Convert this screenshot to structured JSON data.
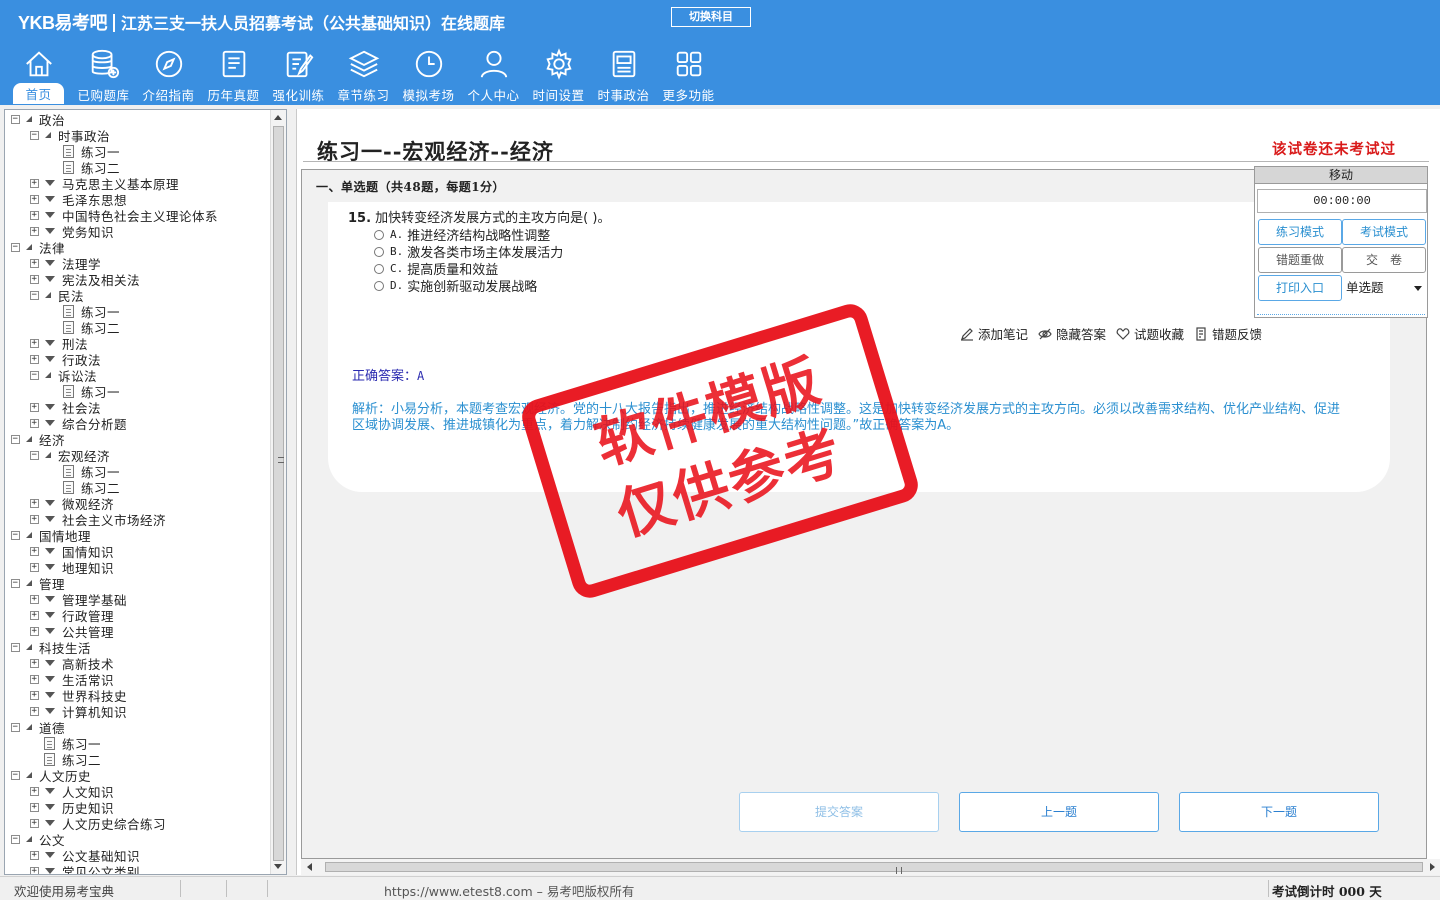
{
  "app": {
    "logo": "YKB易考吧",
    "title": "江苏三支一扶人员招募考试（公共基础知识）在线题库",
    "switch_label": "切换科目"
  },
  "colors": {
    "header": "#3a8fe0",
    "alert": "#d91a1a",
    "analysis": "#2a8fd0",
    "answer": "#2b2bb0",
    "stamp": "#e8101a"
  },
  "toolbar": [
    {
      "label": "首页",
      "icon": "home-icon"
    },
    {
      "label": "已购题库",
      "icon": "database-icon"
    },
    {
      "label": "介绍指南",
      "icon": "compass-icon"
    },
    {
      "label": "历年真题",
      "icon": "document-list-icon"
    },
    {
      "label": "强化训练",
      "icon": "edit-icon"
    },
    {
      "label": "章节练习",
      "icon": "layers-icon"
    },
    {
      "label": "模拟考场",
      "icon": "clock-icon"
    },
    {
      "label": "个人中心",
      "icon": "user-icon"
    },
    {
      "label": "时间设置",
      "icon": "gear-icon"
    },
    {
      "label": "时事政治",
      "icon": "newspaper-icon"
    },
    {
      "label": "更多功能",
      "icon": "grid-icon"
    }
  ],
  "tree": [
    {
      "label": "政治",
      "level": 0,
      "state": "open"
    },
    {
      "label": "时事政治",
      "level": 1,
      "state": "open"
    },
    {
      "label": "练习一",
      "level": 2,
      "state": "doc"
    },
    {
      "label": "练习二",
      "level": 2,
      "state": "doc"
    },
    {
      "label": "马克思主义基本原理",
      "level": 1,
      "state": "closed"
    },
    {
      "label": "毛泽东思想",
      "level": 1,
      "state": "closed"
    },
    {
      "label": "中国特色社会主义理论体系",
      "level": 1,
      "state": "closed"
    },
    {
      "label": "党务知识",
      "level": 1,
      "state": "closed"
    },
    {
      "label": "法律",
      "level": 0,
      "state": "open"
    },
    {
      "label": "法理学",
      "level": 1,
      "state": "closed"
    },
    {
      "label": "宪法及相关法",
      "level": 1,
      "state": "closed"
    },
    {
      "label": "民法",
      "level": 1,
      "state": "open"
    },
    {
      "label": "练习一",
      "level": 2,
      "state": "doc"
    },
    {
      "label": "练习二",
      "level": 2,
      "state": "doc"
    },
    {
      "label": "刑法",
      "level": 1,
      "state": "closed"
    },
    {
      "label": "行政法",
      "level": 1,
      "state": "closed"
    },
    {
      "label": "诉讼法",
      "level": 1,
      "state": "open"
    },
    {
      "label": "练习一",
      "level": 2,
      "state": "doc"
    },
    {
      "label": "社会法",
      "level": 1,
      "state": "closed"
    },
    {
      "label": "综合分析题",
      "level": 1,
      "state": "closed"
    },
    {
      "label": "经济",
      "level": 0,
      "state": "open"
    },
    {
      "label": "宏观经济",
      "level": 1,
      "state": "open"
    },
    {
      "label": "练习一",
      "level": 2,
      "state": "doc"
    },
    {
      "label": "练习二",
      "level": 2,
      "state": "doc"
    },
    {
      "label": "微观经济",
      "level": 1,
      "state": "closed"
    },
    {
      "label": "社会主义市场经济",
      "level": 1,
      "state": "closed"
    },
    {
      "label": "国情地理",
      "level": 0,
      "state": "open"
    },
    {
      "label": "国情知识",
      "level": 1,
      "state": "closed"
    },
    {
      "label": "地理知识",
      "level": 1,
      "state": "closed"
    },
    {
      "label": "管理",
      "level": 0,
      "state": "open"
    },
    {
      "label": "管理学基础",
      "level": 1,
      "state": "closed"
    },
    {
      "label": "行政管理",
      "level": 1,
      "state": "closed"
    },
    {
      "label": "公共管理",
      "level": 1,
      "state": "closed"
    },
    {
      "label": "科技生活",
      "level": 0,
      "state": "open"
    },
    {
      "label": "高新技术",
      "level": 1,
      "state": "closed"
    },
    {
      "label": "生活常识",
      "level": 1,
      "state": "closed"
    },
    {
      "label": "世界科技史",
      "level": 1,
      "state": "closed"
    },
    {
      "label": "计算机知识",
      "level": 1,
      "state": "closed"
    },
    {
      "label": "道德",
      "level": 0,
      "state": "open"
    },
    {
      "label": "练习一",
      "level": 1,
      "state": "doc"
    },
    {
      "label": "练习二",
      "level": 1,
      "state": "doc"
    },
    {
      "label": "人文历史",
      "level": 0,
      "state": "open"
    },
    {
      "label": "人文知识",
      "level": 1,
      "state": "closed"
    },
    {
      "label": "历史知识",
      "level": 1,
      "state": "closed"
    },
    {
      "label": "人文历史综合练习",
      "level": 1,
      "state": "closed"
    },
    {
      "label": "公文",
      "level": 0,
      "state": "open"
    },
    {
      "label": "公文基础知识",
      "level": 1,
      "state": "closed"
    },
    {
      "label": "常见公文类别",
      "level": 1,
      "state": "closed"
    }
  ],
  "paper": {
    "title": "练习一--宏观经济--经济",
    "status": "该试卷还未考试过",
    "section": "一、单选题（共48题，每题1分）"
  },
  "question": {
    "number": "15.",
    "stem": "加快转变经济发展方式的主攻方向是( )。",
    "options": [
      {
        "key": "A.",
        "text": "推进经济结构战略性调整"
      },
      {
        "key": "B.",
        "text": "激发各类市场主体发展活力"
      },
      {
        "key": "C.",
        "text": "提高质量和效益"
      },
      {
        "key": "D.",
        "text": "实施创新驱动发展战略"
      }
    ],
    "tools": [
      {
        "label": "添加笔记",
        "icon": "pencil-icon"
      },
      {
        "label": "隐藏答案",
        "icon": "eye-off-icon"
      },
      {
        "label": "试题收藏",
        "icon": "heart-icon"
      },
      {
        "label": "错题反馈",
        "icon": "feedback-icon"
      }
    ],
    "answer_label": "正确答案：",
    "answer_value": "A",
    "analysis": "解析：小易分析，本题考查宏观经济。党的十八大报告指出，推进经济结构战略性调整。这是加快转变经济发展方式的主攻方向。必须以改善需求结构、优化产业结构、促进区域协调发展、推进城镇化为重点，着力解决制约经济持续健康发展的重大结构性问题。”故正确答案为A。"
  },
  "nav": {
    "submit": "提交答案",
    "prev": "上一题",
    "next": "下一题"
  },
  "control": {
    "move": "移动",
    "timer": "00:00:00",
    "practice_mode": "练习模式",
    "exam_mode": "考试模式",
    "redo_wrong": "错题重做",
    "hand_in": "交　卷",
    "print": "打印入口",
    "type_select": "单选题"
  },
  "watermark": {
    "line1": "软件模版",
    "line2": "仅供参考"
  },
  "status": {
    "welcome": "欢迎使用易考宝典",
    "copyright": "https://www.etest8.com – 易考吧版权所有",
    "countdown": "考试倒计时 000 天"
  }
}
